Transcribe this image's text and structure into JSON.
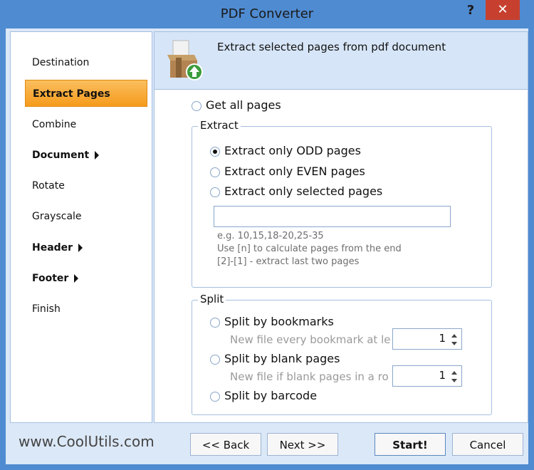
{
  "window": {
    "title": "PDF Converter",
    "help_glyph": "?",
    "close_glyph": "✕"
  },
  "sidebar": {
    "items": [
      {
        "label": "Destination"
      },
      {
        "label": "Extract Pages"
      },
      {
        "label": "Combine"
      },
      {
        "label": "Document"
      },
      {
        "label": "Rotate"
      },
      {
        "label": "Grayscale"
      },
      {
        "label": "Header"
      },
      {
        "label": "Footer"
      },
      {
        "label": "Finish"
      }
    ]
  },
  "header": {
    "text": "Extract selected pages from pdf document"
  },
  "options": {
    "get_all": "Get all pages",
    "extract_group": "Extract",
    "odd": "Extract only ODD pages",
    "even": "Extract only EVEN pages",
    "selected": "Extract only selected pages",
    "pages_value": "",
    "hint1": "e.g. 10,15,18-20,25-35",
    "hint2": "Use [n] to calculate pages from the end",
    "hint3": "[2]-[1] - extract last two pages",
    "split_group": "Split",
    "split_bookmarks": "Split by bookmarks",
    "bookmark_sub": "New file every bookmark at le",
    "bookmark_value": "1",
    "split_blank": "Split by blank pages",
    "blank_sub": "New file if blank pages in a ro",
    "blank_value": "1",
    "split_barcode": "Split by barcode"
  },
  "footer": {
    "site": "www.CoolUtils.com",
    "back": "<< Back",
    "next": "Next >>",
    "start": "Start!",
    "cancel": "Cancel"
  },
  "colors": {
    "accent": "#4f8bd1",
    "active": "#f59b1c",
    "close": "#c7402f"
  }
}
